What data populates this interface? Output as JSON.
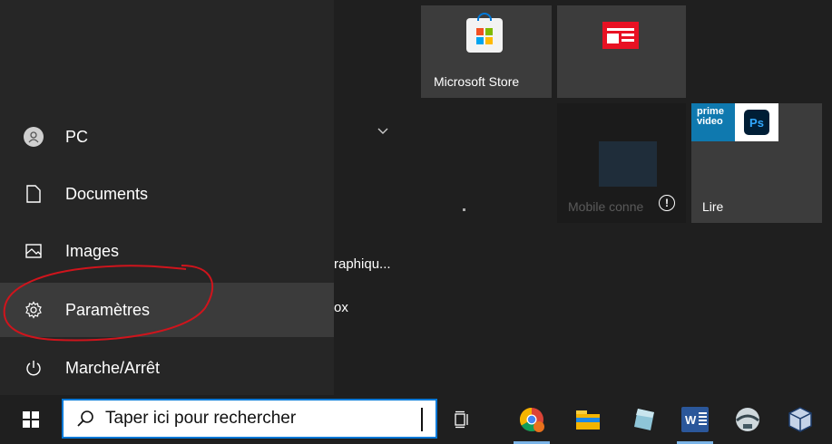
{
  "nav": {
    "items": [
      {
        "label": "PC",
        "icon": "user-icon"
      },
      {
        "label": "Documents",
        "icon": "document-icon"
      },
      {
        "label": "Images",
        "icon": "picture-icon"
      },
      {
        "label": "Paramètres",
        "icon": "gear-icon"
      },
      {
        "label": "Marche/Arrêt",
        "icon": "power-icon"
      }
    ]
  },
  "applist": {
    "item1": "raphiqu...",
    "item2": "ox"
  },
  "tiles": {
    "store": {
      "label": "Microsoft Store",
      "icon": "store-icon"
    },
    "news": {
      "icon": "news-icon",
      "color": "#e81123"
    },
    "mobile": {
      "label": "Mobile conne",
      "badge": "!"
    },
    "play": {
      "label": "Lire",
      "prime_line1": "prime",
      "prime_line2": "video",
      "ps_label": "Ps"
    }
  },
  "taskbar": {
    "search_placeholder": "Taper ici pour rechercher",
    "apps": [
      "chrome-icon",
      "file-explorer-icon",
      "paint-3d-icon",
      "word-icon",
      "app-icon",
      "virtualbox-icon"
    ],
    "word_label": "W"
  },
  "colors": {
    "accent": "#0078d7",
    "annotation": "#d0141c",
    "pane": "#262626"
  }
}
